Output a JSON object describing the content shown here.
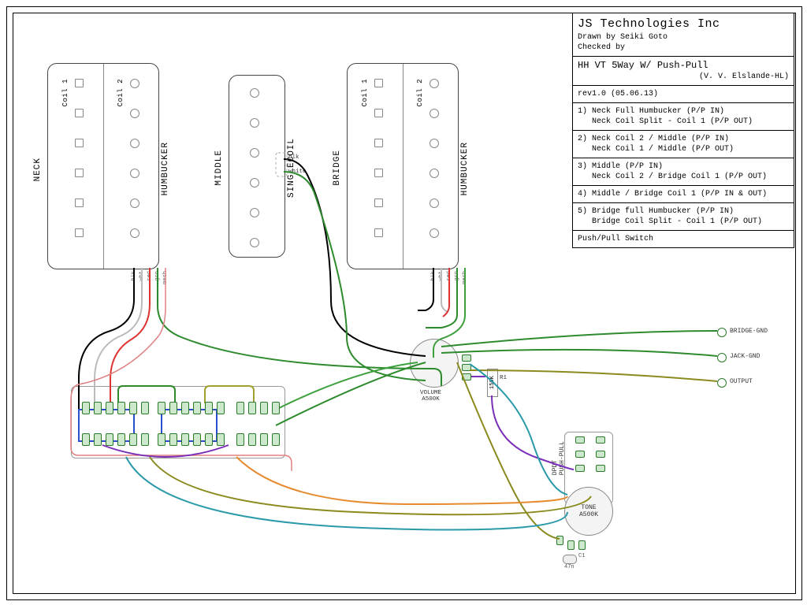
{
  "titleblock": {
    "company": "JS Technologies Inc",
    "drawn_by_label": "Drawn by",
    "drawn_by": "Seiki Goto",
    "checked_by_label": "Checked by",
    "checked_by": "",
    "title_line1": "HH VT 5Way W/ Push-Pull",
    "title_line2": "(V. V. Elslande-HL)",
    "rev": "rev1.0 (05.06.13)",
    "positions": [
      {
        "n": "1)",
        "a": "Neck Full Humbucker (P/P IN)",
        "b": "Neck Coil Split - Coil 1 (P/P OUT)"
      },
      {
        "n": "2)",
        "a": "Neck Coil 2 / Middle (P/P IN)",
        "b": "Neck Coil 1 / Middle (P/P OUT)"
      },
      {
        "n": "3)",
        "a": "Middle (P/P IN)",
        "b": "Neck Coil 2 / Bridge Coil 1 (P/P OUT)"
      },
      {
        "n": "4)",
        "a": "Middle / Bridge Coil 1 (P/P IN & OUT)",
        "b": ""
      },
      {
        "n": "5)",
        "a": "Bridge full Humbucker (P/P IN)",
        "b": "Bridge Coil Split - Coil 1 (P/P OUT)"
      }
    ],
    "pp_label": "Push/Pull Switch"
  },
  "pickups": {
    "neck": {
      "name": "NECK",
      "type": "HUMBUCKER",
      "coil1": "Coil 1",
      "coil2": "Coil 2",
      "wires": [
        "blk",
        "wht",
        "red",
        "grn",
        "mesh"
      ]
    },
    "middle": {
      "name": "MIDDLE",
      "type": "SINGLECOIL",
      "wires": [
        "blk",
        "white"
      ]
    },
    "bridge": {
      "name": "BRIDGE",
      "type": "HUMBUCKER",
      "coil1": "Coil 1",
      "coil2": "Coil 2",
      "wires": [
        "blk",
        "wht",
        "red",
        "grn",
        "mesh"
      ]
    }
  },
  "components": {
    "volume": {
      "label": "VOLUME",
      "value": "A500K"
    },
    "tone": {
      "label": "TONE",
      "value": "A500K"
    },
    "dpdt": {
      "label": "DPDT",
      "sub": "PUSH-PULL"
    },
    "r1": {
      "name": "R1",
      "value": "150K"
    },
    "c1": {
      "name": "C1",
      "value": "47n"
    }
  },
  "outputs": {
    "bridge_gnd": "BRIDGE-GND",
    "jack_gnd": "JACK-GND",
    "output": "OUTPUT"
  },
  "wire_colors": {
    "green": "#2d8a2d",
    "olive": "#8a8a1e",
    "black": "#000",
    "white": "#bbb",
    "red": "#d33",
    "blue": "#2a4fcf",
    "purple": "#7a2fb8",
    "teal": "#2a9aa8",
    "orange": "#e68a2e"
  }
}
